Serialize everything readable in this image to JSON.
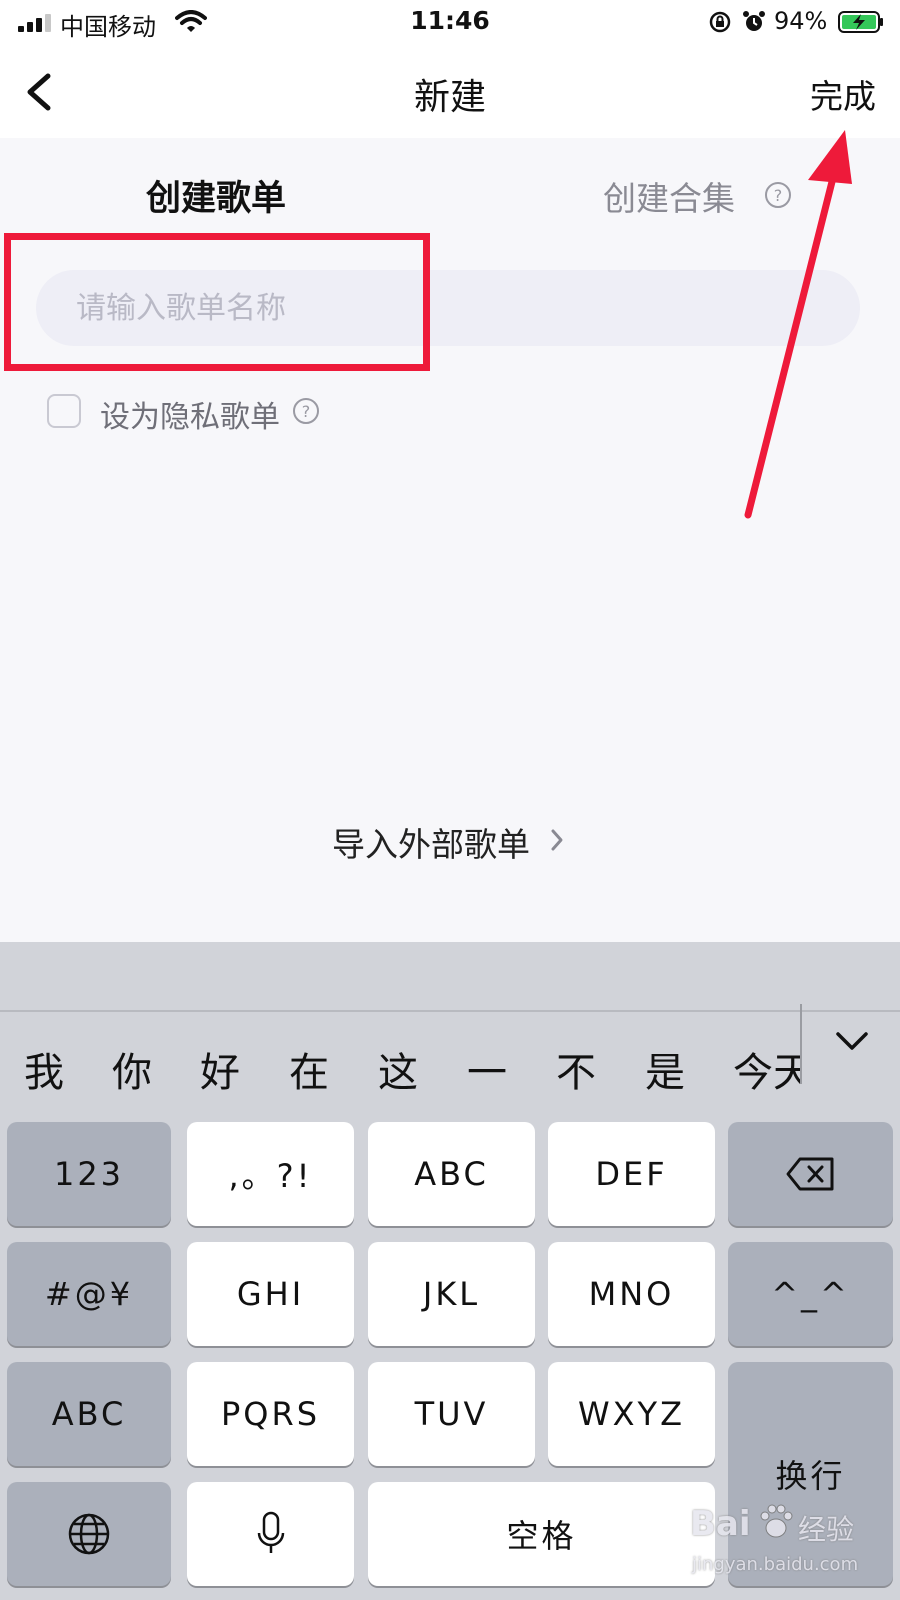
{
  "status_bar": {
    "carrier": "中国移动",
    "time": "11:46",
    "battery_percent": "94%",
    "icons": [
      "signal-icon",
      "wifi-icon",
      "rotation-lock-icon",
      "alarm-icon",
      "battery-charging-icon"
    ]
  },
  "nav": {
    "title": "新建",
    "done_label": "完成",
    "back_icon": "chevron-left-icon"
  },
  "tabs": {
    "create_playlist": "创建歌单",
    "create_collection": "创建合集"
  },
  "form": {
    "name_placeholder": "请输入歌单名称",
    "name_value": "",
    "private_label": "设为隐私歌单",
    "private_checked": false
  },
  "import_link": "导入外部歌单",
  "annotation": {
    "highlight_color": "#ee1a3a"
  },
  "keyboard": {
    "candidates": [
      "我",
      "你",
      "好",
      "在",
      "这",
      "一",
      "不",
      "是",
      "今天"
    ],
    "keys": {
      "num": "123",
      "punct": ",。?!",
      "abc1": "ABC",
      "def": "DEF",
      "symbols": "#@¥",
      "ghi": "GHI",
      "jkl": "JKL",
      "mno": "MNO",
      "emoticon": "^_^",
      "abc2": "ABC",
      "pqrs": "PQRS",
      "tuv": "TUV",
      "wxyz": "WXYZ",
      "return": "换行",
      "space": "空格"
    }
  },
  "watermark": {
    "brand": "Bai",
    "brand_cn": "经验",
    "url": "jingyan.baidu.com"
  }
}
